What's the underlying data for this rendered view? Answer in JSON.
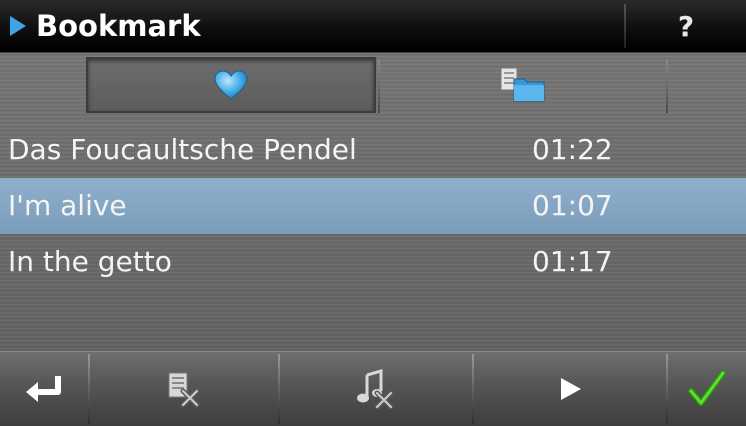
{
  "header": {
    "title": "Bookmark",
    "help_label": "?"
  },
  "tabs": [
    {
      "name": "favorites",
      "icon": "heart-icon",
      "active": true
    },
    {
      "name": "folders",
      "icon": "folder-icon",
      "active": false
    }
  ],
  "tracks": [
    {
      "title": "Das Foucaultsche Pendel",
      "time": "01:22",
      "selected": false
    },
    {
      "title": "I'm alive",
      "time": "01:07",
      "selected": true
    },
    {
      "title": "In the getto",
      "time": "01:17",
      "selected": false
    }
  ],
  "toolbar": {
    "buttons": [
      "back-icon",
      "delete-all-icon",
      "delete-track-icon",
      "play-icon",
      "confirm-icon"
    ]
  },
  "colors": {
    "accent": "#3ea4e6",
    "selection": "#86a7c3",
    "confirm": "#4cd020"
  }
}
